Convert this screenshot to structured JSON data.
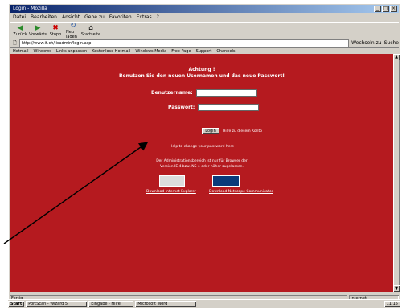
{
  "window": {
    "title": "Login - Mozilla"
  },
  "menubar": {
    "items": [
      "Datei",
      "Bearbeiten",
      "Ansicht",
      "Gehe zu",
      "Favoriten",
      "Extras",
      "?"
    ]
  },
  "toolbar": {
    "back": "Zurück",
    "forward": "Vorwärts",
    "stop": "Stopp",
    "reload": "Neu laden",
    "home": "Startseite"
  },
  "address": {
    "value": "http://www.it.ch/iisadmin/login.asp",
    "go_label": "Wechseln zu",
    "search_label": "Suche"
  },
  "links": {
    "items": [
      "Hotmail",
      "Windows",
      "Links anpassen",
      "Kostenlose Hotmail",
      "Windows Media",
      "Free Page",
      "Support",
      "Channels"
    ]
  },
  "page": {
    "heading1": "Achtung !",
    "heading2": "Benutzen Sie den neuen Usernamen und das neue Passwort!",
    "username_label": "Benutzername:",
    "password_label": "Passwort:",
    "login_button": "Login",
    "forgot_link": "Hilfe zu diesem Konto",
    "small1": "Help to change your password here",
    "small2a": "Der Administrationsbereich ist nur für Browser der",
    "small2b": "Version IE 4 bzw. NS 4 oder höher zugelassen.",
    "logo1": "MS IE",
    "logo2": "Netscape",
    "footer_link1": "Download Internet Explorer",
    "footer_link2": "Download Netscape Communicator"
  },
  "statusbar": {
    "left": "Fertig",
    "zone": "Internet"
  },
  "taskbar": {
    "start": "Start",
    "tasks": [
      "PortScan - Wizard 5",
      "Eingabe - Hilfe",
      "Microsoft Word"
    ],
    "clock": "11:15"
  }
}
